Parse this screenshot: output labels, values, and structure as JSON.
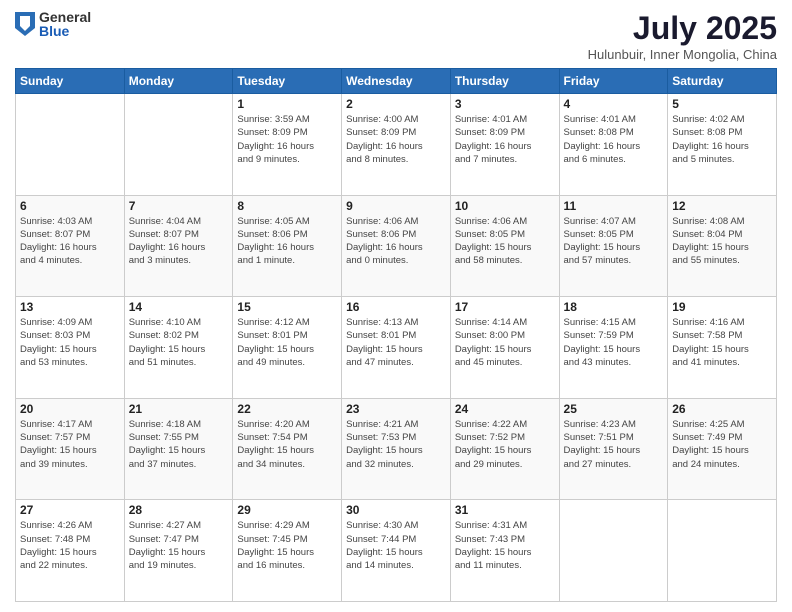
{
  "logo": {
    "general": "General",
    "blue": "Blue"
  },
  "title": "July 2025",
  "subtitle": "Hulunbuir, Inner Mongolia, China",
  "days_of_week": [
    "Sunday",
    "Monday",
    "Tuesday",
    "Wednesday",
    "Thursday",
    "Friday",
    "Saturday"
  ],
  "weeks": [
    [
      {
        "day": "",
        "info": ""
      },
      {
        "day": "",
        "info": ""
      },
      {
        "day": "1",
        "info": "Sunrise: 3:59 AM\nSunset: 8:09 PM\nDaylight: 16 hours\nand 9 minutes."
      },
      {
        "day": "2",
        "info": "Sunrise: 4:00 AM\nSunset: 8:09 PM\nDaylight: 16 hours\nand 8 minutes."
      },
      {
        "day": "3",
        "info": "Sunrise: 4:01 AM\nSunset: 8:09 PM\nDaylight: 16 hours\nand 7 minutes."
      },
      {
        "day": "4",
        "info": "Sunrise: 4:01 AM\nSunset: 8:08 PM\nDaylight: 16 hours\nand 6 minutes."
      },
      {
        "day": "5",
        "info": "Sunrise: 4:02 AM\nSunset: 8:08 PM\nDaylight: 16 hours\nand 5 minutes."
      }
    ],
    [
      {
        "day": "6",
        "info": "Sunrise: 4:03 AM\nSunset: 8:07 PM\nDaylight: 16 hours\nand 4 minutes."
      },
      {
        "day": "7",
        "info": "Sunrise: 4:04 AM\nSunset: 8:07 PM\nDaylight: 16 hours\nand 3 minutes."
      },
      {
        "day": "8",
        "info": "Sunrise: 4:05 AM\nSunset: 8:06 PM\nDaylight: 16 hours\nand 1 minute."
      },
      {
        "day": "9",
        "info": "Sunrise: 4:06 AM\nSunset: 8:06 PM\nDaylight: 16 hours\nand 0 minutes."
      },
      {
        "day": "10",
        "info": "Sunrise: 4:06 AM\nSunset: 8:05 PM\nDaylight: 15 hours\nand 58 minutes."
      },
      {
        "day": "11",
        "info": "Sunrise: 4:07 AM\nSunset: 8:05 PM\nDaylight: 15 hours\nand 57 minutes."
      },
      {
        "day": "12",
        "info": "Sunrise: 4:08 AM\nSunset: 8:04 PM\nDaylight: 15 hours\nand 55 minutes."
      }
    ],
    [
      {
        "day": "13",
        "info": "Sunrise: 4:09 AM\nSunset: 8:03 PM\nDaylight: 15 hours\nand 53 minutes."
      },
      {
        "day": "14",
        "info": "Sunrise: 4:10 AM\nSunset: 8:02 PM\nDaylight: 15 hours\nand 51 minutes."
      },
      {
        "day": "15",
        "info": "Sunrise: 4:12 AM\nSunset: 8:01 PM\nDaylight: 15 hours\nand 49 minutes."
      },
      {
        "day": "16",
        "info": "Sunrise: 4:13 AM\nSunset: 8:01 PM\nDaylight: 15 hours\nand 47 minutes."
      },
      {
        "day": "17",
        "info": "Sunrise: 4:14 AM\nSunset: 8:00 PM\nDaylight: 15 hours\nand 45 minutes."
      },
      {
        "day": "18",
        "info": "Sunrise: 4:15 AM\nSunset: 7:59 PM\nDaylight: 15 hours\nand 43 minutes."
      },
      {
        "day": "19",
        "info": "Sunrise: 4:16 AM\nSunset: 7:58 PM\nDaylight: 15 hours\nand 41 minutes."
      }
    ],
    [
      {
        "day": "20",
        "info": "Sunrise: 4:17 AM\nSunset: 7:57 PM\nDaylight: 15 hours\nand 39 minutes."
      },
      {
        "day": "21",
        "info": "Sunrise: 4:18 AM\nSunset: 7:55 PM\nDaylight: 15 hours\nand 37 minutes."
      },
      {
        "day": "22",
        "info": "Sunrise: 4:20 AM\nSunset: 7:54 PM\nDaylight: 15 hours\nand 34 minutes."
      },
      {
        "day": "23",
        "info": "Sunrise: 4:21 AM\nSunset: 7:53 PM\nDaylight: 15 hours\nand 32 minutes."
      },
      {
        "day": "24",
        "info": "Sunrise: 4:22 AM\nSunset: 7:52 PM\nDaylight: 15 hours\nand 29 minutes."
      },
      {
        "day": "25",
        "info": "Sunrise: 4:23 AM\nSunset: 7:51 PM\nDaylight: 15 hours\nand 27 minutes."
      },
      {
        "day": "26",
        "info": "Sunrise: 4:25 AM\nSunset: 7:49 PM\nDaylight: 15 hours\nand 24 minutes."
      }
    ],
    [
      {
        "day": "27",
        "info": "Sunrise: 4:26 AM\nSunset: 7:48 PM\nDaylight: 15 hours\nand 22 minutes."
      },
      {
        "day": "28",
        "info": "Sunrise: 4:27 AM\nSunset: 7:47 PM\nDaylight: 15 hours\nand 19 minutes."
      },
      {
        "day": "29",
        "info": "Sunrise: 4:29 AM\nSunset: 7:45 PM\nDaylight: 15 hours\nand 16 minutes."
      },
      {
        "day": "30",
        "info": "Sunrise: 4:30 AM\nSunset: 7:44 PM\nDaylight: 15 hours\nand 14 minutes."
      },
      {
        "day": "31",
        "info": "Sunrise: 4:31 AM\nSunset: 7:43 PM\nDaylight: 15 hours\nand 11 minutes."
      },
      {
        "day": "",
        "info": ""
      },
      {
        "day": "",
        "info": ""
      }
    ]
  ]
}
